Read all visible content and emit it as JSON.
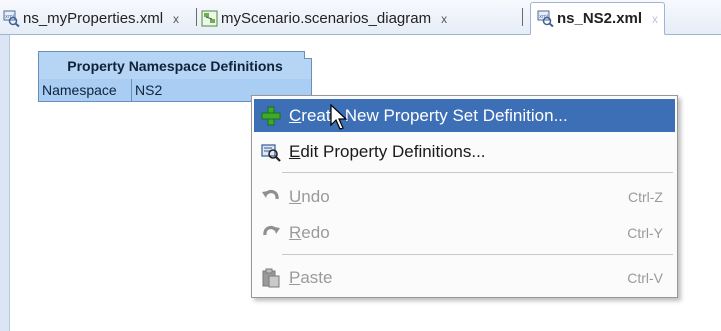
{
  "tabs": [
    {
      "label": "ns_myProperties.xml",
      "close": "x"
    },
    {
      "label": "myScenario.scenarios_diagram",
      "close": "x"
    },
    {
      "label": "ns_NS2.xml",
      "close": "x"
    }
  ],
  "namespace_box": {
    "title": "Property Namespace Definitions",
    "key": "Namespace",
    "value": "NS2"
  },
  "menu": {
    "create": {
      "ul": "C",
      "rest": "reate New Property Set Definition..."
    },
    "edit": {
      "ul": "E",
      "rest": "dit Property Definitions..."
    },
    "undo": {
      "ul": "U",
      "rest": "ndo",
      "shortcut": "Ctrl-Z"
    },
    "redo": {
      "ul": "R",
      "rest": "edo",
      "shortcut": "Ctrl-Y"
    },
    "paste": {
      "ul": "P",
      "rest": "aste",
      "shortcut": "Ctrl-V"
    }
  },
  "colors": {
    "menu_highlight": "#3d6fb6",
    "namespace_header": "#b6d5f5",
    "namespace_row": "#a9cdf3"
  }
}
